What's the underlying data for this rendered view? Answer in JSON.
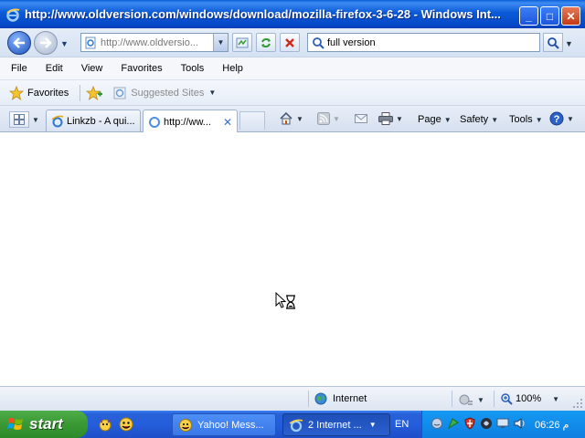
{
  "window": {
    "title": "http://www.oldversion.com/windows/download/mozilla-firefox-3-6-28 - Windows Int...",
    "buttons": {
      "minimize": "_",
      "maximize": "□",
      "close": "✕"
    }
  },
  "address_bar": {
    "url": "http://www.oldversio..."
  },
  "search": {
    "query": "full version"
  },
  "menu": {
    "items": [
      "File",
      "Edit",
      "View",
      "Favorites",
      "Tools",
      "Help"
    ]
  },
  "favorites_bar": {
    "favorites_label": "Favorites",
    "suggested_label": "Suggested Sites"
  },
  "tabs": [
    {
      "label": "Linkzb - A qui..."
    },
    {
      "label": "http://ww...",
      "close": "✕"
    }
  ],
  "command_bar": {
    "page": "Page",
    "safety": "Safety",
    "tools": "Tools"
  },
  "status_bar": {
    "zone": "Internet",
    "zoom": "100%"
  },
  "taskbar": {
    "start": "start",
    "buttons": [
      "Yahoo! Mess...",
      "2 Internet ..."
    ],
    "language": "EN",
    "clock": "06:26 م"
  },
  "colors": {
    "title_blue": "#0647c7",
    "start_green": "#3c9a36",
    "tray_blue": "#0f7fe0"
  }
}
